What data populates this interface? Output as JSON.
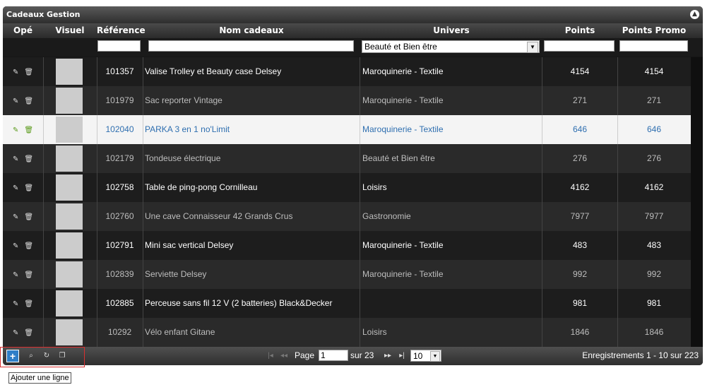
{
  "title": "Cadeaux Gestion",
  "columns": [
    "Opé",
    "Visuel",
    "Référence",
    "Nom cadeaux",
    "Univers",
    "Points",
    "Points Promo"
  ],
  "filter_univers": "Beauté et Bien être",
  "rows": [
    {
      "ref": "101357",
      "name": "Valise Trolley et Beauty case Delsey",
      "univers": "Maroquinerie - Textile",
      "points": "4154",
      "promo": "4154",
      "img": "suitcase-image"
    },
    {
      "ref": "101979",
      "name": "Sac reporter Vintage",
      "univers": "Maroquinerie - Textile",
      "points": "271",
      "promo": "271",
      "img": "bag-image"
    },
    {
      "ref": "102040",
      "name": "PARKA 3  en 1 no'Limit",
      "univers": "Maroquinerie - Textile",
      "points": "646",
      "promo": "646",
      "img": "parka-image"
    },
    {
      "ref": "102179",
      "name": "Tondeuse électrique",
      "univers": "Beauté et Bien être",
      "points": "276",
      "promo": "276",
      "img": "trimmer-image"
    },
    {
      "ref": "102758",
      "name": "Table de ping-pong Cornilleau",
      "univers": "Loisirs",
      "points": "4162",
      "promo": "4162",
      "img": "ping-pong-table-image"
    },
    {
      "ref": "102760",
      "name": "Une cave Connaisseur 42 Grands Crus",
      "univers": "Gastronomie",
      "points": "7977",
      "promo": "7977",
      "img": "wine-bottles-image"
    },
    {
      "ref": "102791",
      "name": "Mini sac vertical Delsey",
      "univers": "Maroquinerie - Textile",
      "points": "483",
      "promo": "483",
      "img": "vertical-bag-image"
    },
    {
      "ref": "102839",
      "name": "Serviette Delsey",
      "univers": "Maroquinerie - Textile",
      "points": "992",
      "promo": "992",
      "img": "briefcase-image"
    },
    {
      "ref": "102885",
      "name": "Perceuse sans fil 12 V (2 batteries) Black&Decker",
      "univers": "",
      "points": "981",
      "promo": "981",
      "img": "drill-image"
    },
    {
      "ref": "10292",
      "name": "Vélo enfant Gitane",
      "univers": "Loisirs",
      "points": "1846",
      "promo": "1846",
      "img": "kids-bike-image"
    }
  ],
  "pager": {
    "page_label": "Page",
    "page_value": "1",
    "of_label": "sur 23",
    "page_size": "10",
    "records": "Enregistrements 1 - 10 sur 223"
  },
  "tooltip": "Ajouter une ligne",
  "add_label": "+"
}
